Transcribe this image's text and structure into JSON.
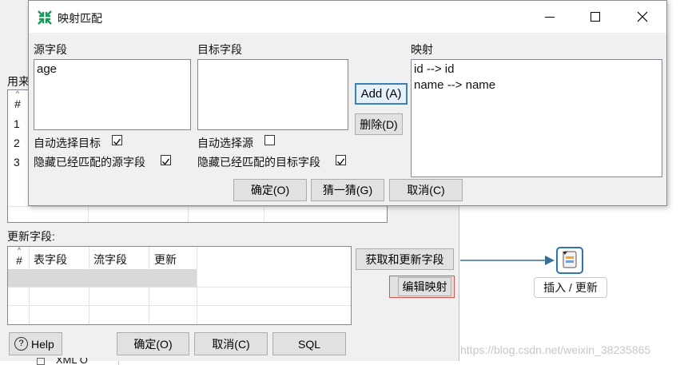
{
  "bg_window": {
    "upper_label": "用来",
    "upper_rows": [
      "1",
      "2",
      "3"
    ],
    "upper_hash": "#",
    "update_fields_label": "更新字段:",
    "table_headers": [
      "#",
      "表字段",
      "流字段",
      "更新"
    ],
    "get_update_fields_btn": "获取和更新字段",
    "edit_mapping_btn": "编辑映射",
    "help_btn": "Help",
    "ok_btn": "确定(O)",
    "cancel_btn": "取消(C)",
    "sql_btn": "SQL",
    "bottom_cut_text": "XML O"
  },
  "canvas": {
    "step_label": "插入 / 更新",
    "watermark": "https://blog.csdn.net/weixin_38235865"
  },
  "dialog": {
    "title": "映射匹配",
    "source_label": "源字段",
    "source_items": [
      "age"
    ],
    "target_label": "目标字段",
    "target_items": [],
    "mapping_label": "映射",
    "mapping_items": [
      "id --> id",
      "name --> name"
    ],
    "add_btn": "Add (A)",
    "delete_btn": "删除(D)",
    "auto_target_label": "自动选择目标",
    "hide_source_label": "隐藏已经匹配的源字段",
    "auto_source_label": "自动选择源",
    "hide_target_label": "隐藏已经匹配的目标字段",
    "ok_btn": "确定(O)",
    "guess_btn": "猜一猜(G)",
    "cancel_btn": "取消(C)",
    "auto_target_checked": true,
    "hide_source_checked": true,
    "auto_source_checked": false,
    "hide_target_checked": true
  },
  "colors": {
    "accent": "#1a7fa8",
    "focus_border": "#3c7fb1",
    "add_btn_bg": "#e5f1fb"
  }
}
